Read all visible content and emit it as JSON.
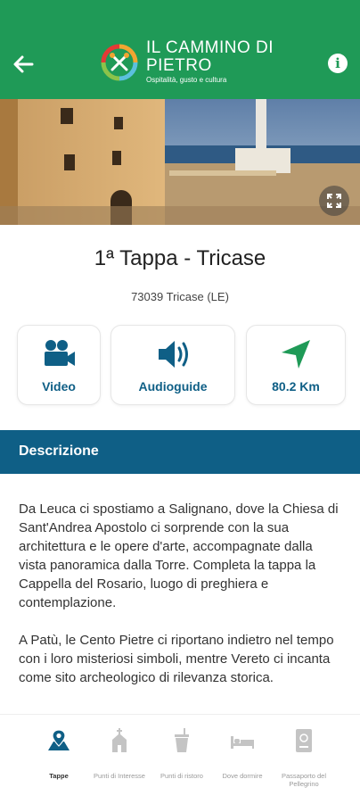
{
  "header": {
    "title": "IL CAMMINO DI PIETRO",
    "subtitle": "Ospitalità, gusto e cultura",
    "brand_color": "#1f9a57"
  },
  "stage": {
    "title": "1ª Tappa - Tricase",
    "address": "73039 Tricase (LE)"
  },
  "actions": [
    {
      "label": "Video",
      "icon": "video-camera-icon"
    },
    {
      "label": "Audioguide",
      "icon": "speaker-icon"
    },
    {
      "label": "80.2 Km",
      "icon": "navigation-arrow-icon"
    }
  ],
  "description": {
    "heading": "Descrizione",
    "paragraphs": [
      "Da Leuca ci spostiamo a Salignano, dove la Chiesa di Sant'Andrea Apostolo ci sorprende con la sua architettura e le opere d'arte, accompagnate dalla vista panoramica dalla Torre. Completa la tappa la Cappella del Rosario, luogo di preghiera e contemplazione.",
      "A Patù, le Cento Pietre ci riportano indietro nel tempo con i loro misteriosi simboli, mentre Vereto ci incanta come sito archeologico di rilevanza storica."
    ],
    "bar_color": "#0f5f86"
  },
  "nav": [
    {
      "label": "Tappe",
      "icon": "map-pin-icon",
      "active": true
    },
    {
      "label": "Punti di Interesse",
      "icon": "church-icon",
      "active": false
    },
    {
      "label": "Punti di ristoro",
      "icon": "drink-cup-icon",
      "active": false
    },
    {
      "label": "Dove dormire",
      "icon": "bed-icon",
      "active": false
    },
    {
      "label": "Passaporto del Pellegrino",
      "icon": "passport-icon",
      "active": false
    }
  ]
}
